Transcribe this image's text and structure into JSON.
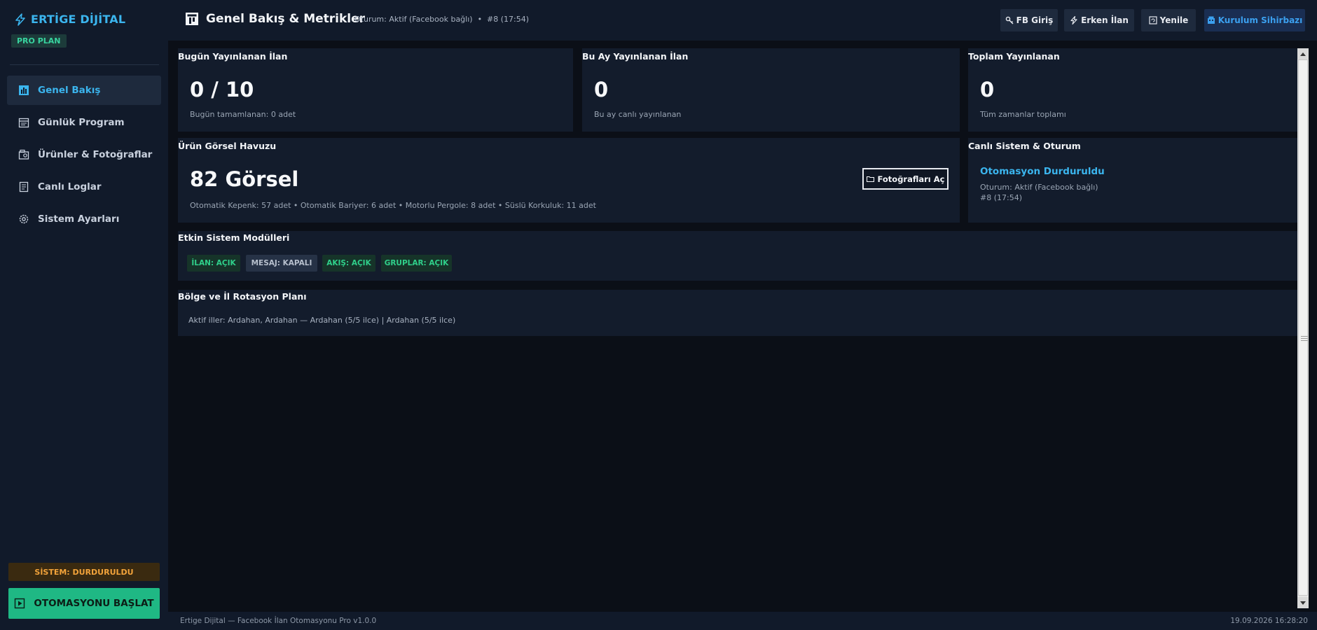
{
  "app": {
    "brand": "ERTİGE DİJİTAL",
    "plan": "PRO PLAN"
  },
  "sidebar": {
    "items": [
      {
        "label": "Genel Bakış",
        "icon": "chart-icon"
      },
      {
        "label": "Günlük Program",
        "icon": "calendar-icon"
      },
      {
        "label": "Ürünler & Fotoğraflar",
        "icon": "photos-icon"
      },
      {
        "label": "Canlı Loglar",
        "icon": "log-icon"
      },
      {
        "label": "Sistem Ayarları",
        "icon": "gear-icon"
      }
    ],
    "system_status": "SİSTEM: DURDURULDU",
    "start_button": "OTOMASYONU BAŞLAT"
  },
  "header": {
    "title": "Genel Bakış & Metrikler",
    "session": "Oturum: Aktif (Facebook bağlı)  •  #8 (17:54)",
    "buttons": {
      "fb_login": "FB Giriş",
      "early_post": "Erken İlan",
      "refresh": "Yenile",
      "setup_wizard": "Kurulum Sihirbazı"
    }
  },
  "cards": {
    "today": {
      "title": "Bugün Yayınlanan İlan",
      "value": "0 / 10",
      "sub": "Bugün tamamlanan: 0 adet"
    },
    "month": {
      "title": "Bu Ay Yayınlanan İlan",
      "value": "0",
      "sub": "Bu ay canlı yayınlanan"
    },
    "total": {
      "title": "Toplam Yayınlanan",
      "value": "0",
      "sub": "Tüm zamanlar toplamı"
    },
    "image_pool": {
      "title": "Ürün Görsel Havuzu",
      "value": "82 Görsel",
      "sub": "Otomatik Kepenk: 57 adet • Otomatik Bariyer: 6 adet • Motorlu Pergole: 8 adet • Süslü Korkuluk: 11 adet",
      "button": "Fotoğrafları Aç"
    },
    "live_system": {
      "title": "Canlı Sistem & Oturum",
      "status": "Otomasyon Durduruldu",
      "session_line1": "Oturum: Aktif (Facebook bağlı)",
      "session_line2": "#8 (17:54)"
    },
    "modules": {
      "title": "Etkin Sistem Modülleri",
      "badges": [
        {
          "label": "İLAN: AÇIK",
          "state": "on"
        },
        {
          "label": "MESAJ: KAPALI",
          "state": "off"
        },
        {
          "label": "AKIŞ: AÇIK",
          "state": "on"
        },
        {
          "label": "GRUPLAR: AÇIK",
          "state": "on"
        }
      ]
    },
    "region": {
      "title": "Bölge ve İl Rotasyon Planı",
      "text": "Aktif iller: Ardahan, Ardahan — Ardahan (5/5 ilce) | Ardahan (5/5 ilce)"
    }
  },
  "footer": {
    "left": "Ertige Dijital — Facebook İlan Otomasyonu Pro v1.0.0",
    "right": "19.09.2026 16:28:20"
  },
  "colors": {
    "accent": "#3bb5ee",
    "success": "#1fb884",
    "warning": "#f2a33a",
    "background": "#0b0f17",
    "panel": "#131c2c"
  }
}
